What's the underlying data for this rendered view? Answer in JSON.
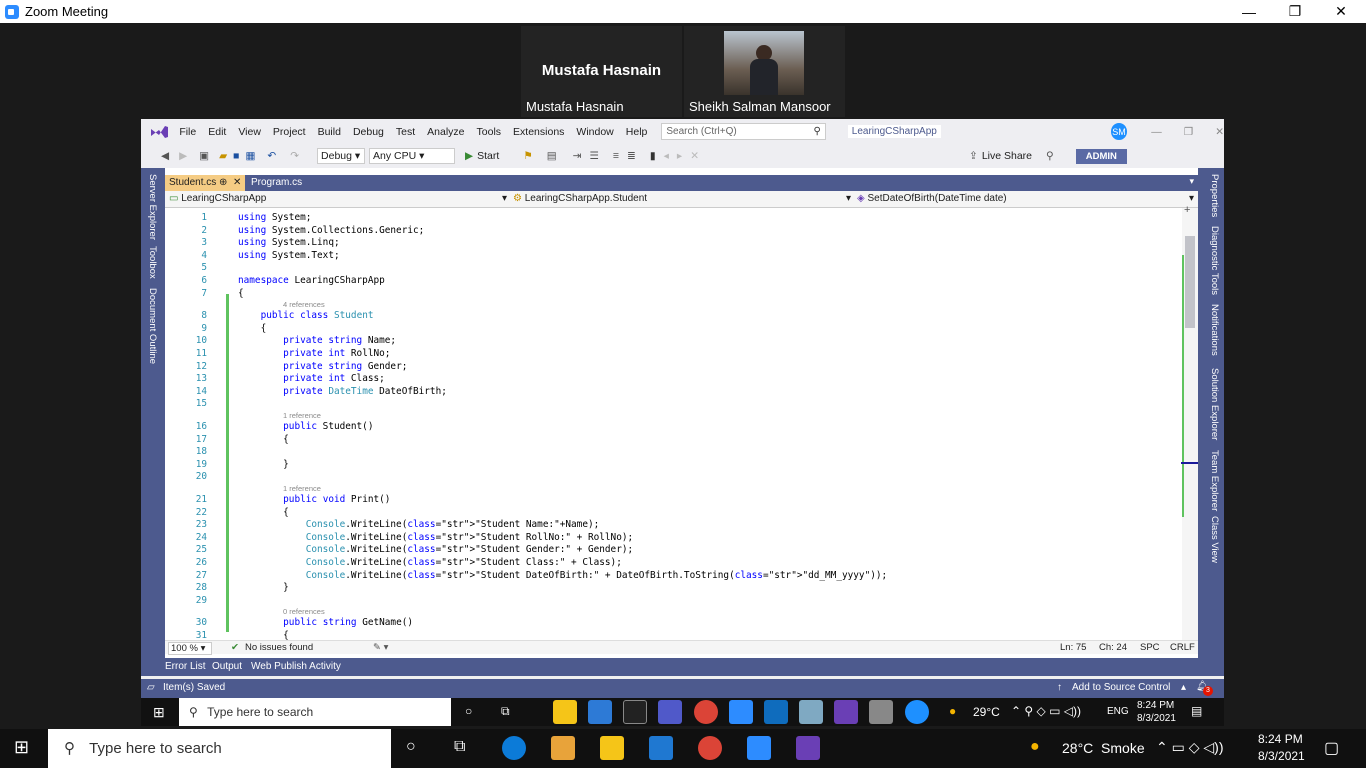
{
  "zoom": {
    "title": "Zoom Meeting",
    "participant1": "Mustafa Hasnain",
    "participant1_label": "Mustafa Hasnain",
    "participant2_label": "Sheikh Salman Mansoor"
  },
  "vs": {
    "menu": [
      "File",
      "Edit",
      "View",
      "Project",
      "Build",
      "Debug",
      "Test",
      "Analyze",
      "Tools",
      "Extensions",
      "Window",
      "Help"
    ],
    "search_placeholder": "Search (Ctrl+Q)",
    "project": "LearingCSharpApp",
    "avatar": "SM",
    "toolbar": {
      "config": "Debug",
      "platform": "Any CPU",
      "start": "Start",
      "live_share": "Live Share",
      "admin": "ADMIN"
    },
    "left_tabs": [
      "Server Explorer",
      "Toolbox",
      "Document Outline"
    ],
    "right_tabs": [
      "Properties",
      "Diagnostic Tools",
      "Notifications",
      "Solution Explorer",
      "Team Explorer",
      "Class View"
    ],
    "tabs": [
      "Student.cs",
      "Program.cs"
    ],
    "nav": [
      "LearingCSharpApp",
      "LearingCSharpApp.Student",
      "SetDateOfBirth(DateTime date)"
    ],
    "code": [
      {
        "n": "1",
        "t": "using System;"
      },
      {
        "n": "2",
        "t": "using System.Collections.Generic;"
      },
      {
        "n": "3",
        "t": "using System.Linq;"
      },
      {
        "n": "4",
        "t": "using System.Text;"
      },
      {
        "n": "5",
        "t": ""
      },
      {
        "n": "6",
        "t": "namespace LearingCSharpApp"
      },
      {
        "n": "7",
        "t": "{"
      },
      {
        "n": "",
        "t": "4 references",
        "ref": true
      },
      {
        "n": "8",
        "t": "    public class Student"
      },
      {
        "n": "9",
        "t": "    {"
      },
      {
        "n": "10",
        "t": "        private string Name;"
      },
      {
        "n": "11",
        "t": "        private int RollNo;"
      },
      {
        "n": "12",
        "t": "        private string Gender;"
      },
      {
        "n": "13",
        "t": "        private int Class;"
      },
      {
        "n": "14",
        "t": "        private DateTime DateOfBirth;"
      },
      {
        "n": "15",
        "t": ""
      },
      {
        "n": "",
        "t": "1 reference",
        "ref": true
      },
      {
        "n": "16",
        "t": "        public Student()"
      },
      {
        "n": "17",
        "t": "        {"
      },
      {
        "n": "18",
        "t": ""
      },
      {
        "n": "19",
        "t": "        }"
      },
      {
        "n": "20",
        "t": ""
      },
      {
        "n": "",
        "t": "1 reference",
        "ref": true
      },
      {
        "n": "21",
        "t": "        public void Print()"
      },
      {
        "n": "22",
        "t": "        {"
      },
      {
        "n": "23",
        "t": "            Console.WriteLine(\"Student Name:\"+Name);"
      },
      {
        "n": "24",
        "t": "            Console.WriteLine(\"Student RollNo:\" + RollNo);"
      },
      {
        "n": "25",
        "t": "            Console.WriteLine(\"Student Gender:\" + Gender);"
      },
      {
        "n": "26",
        "t": "            Console.WriteLine(\"Student Class:\" + Class);"
      },
      {
        "n": "27",
        "t": "            Console.WriteLine(\"Student DateOfBirth:\" + DateOfBirth.ToString(\"dd_MM_yyyy\"));"
      },
      {
        "n": "28",
        "t": "        }"
      },
      {
        "n": "29",
        "t": ""
      },
      {
        "n": "",
        "t": "0 references",
        "ref": true
      },
      {
        "n": "30",
        "t": "        public string GetName()"
      },
      {
        "n": "31",
        "t": "        {"
      }
    ],
    "status": {
      "zoom": "100 %",
      "issues": "No issues found",
      "ln": "Ln: 75",
      "ch": "Ch: 24",
      "spc": "SPC",
      "crlf": "CRLF"
    },
    "bottom_tabs": [
      "Error List",
      "Output",
      "Web Publish Activity"
    ],
    "saved": "Item(s) Saved",
    "source_control": "Add to Source Control",
    "notif_count": "3"
  },
  "inner_taskbar": {
    "search": "Type here to search",
    "weather": "29°C",
    "lang": "ENG",
    "time": "8:24 PM",
    "date": "8/3/2021"
  },
  "taskbar": {
    "search": "Type here to search",
    "weather": "28°C  Smoke",
    "time": "8:24 PM",
    "date": "8/3/2021"
  }
}
